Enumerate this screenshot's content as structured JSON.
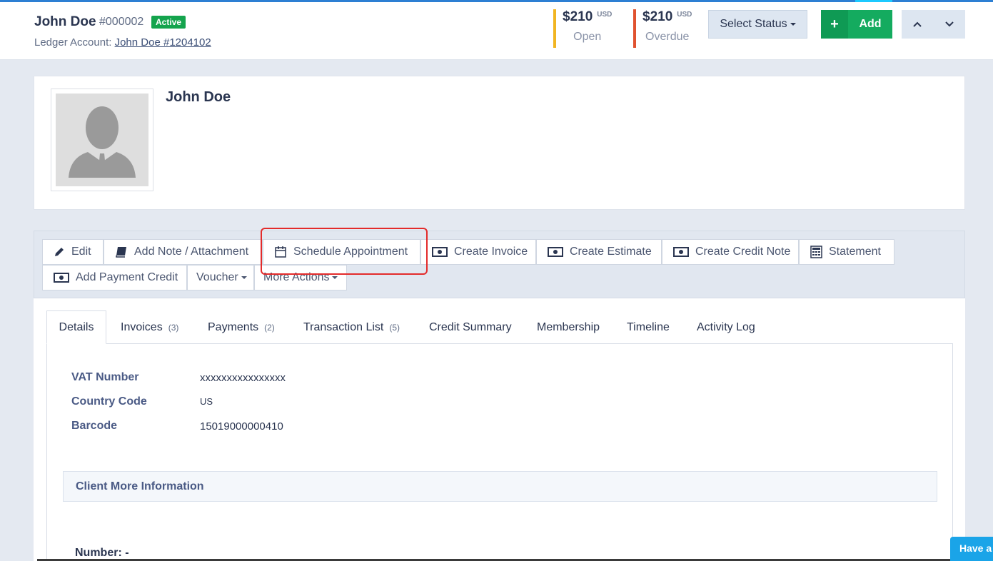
{
  "header": {
    "client_name": "John Doe",
    "client_code": "#000002",
    "status_badge": "Active",
    "ledger_label": "Ledger Account:",
    "ledger_link": "John Doe #1204102",
    "open": {
      "value": "$210",
      "currency": "USD",
      "label": "Open"
    },
    "overdue": {
      "value": "$210",
      "currency": "USD",
      "label": "Overdue"
    },
    "select_status": "Select Status",
    "add_label": "Add"
  },
  "profile": {
    "name": "John Doe"
  },
  "actions": {
    "edit": "Edit",
    "add_note": "Add Note / Attachment",
    "schedule": "Schedule Appointment",
    "create_invoice": "Create Invoice",
    "create_estimate": "Create Estimate",
    "create_credit_note": "Create Credit Note",
    "statement": "Statement",
    "add_payment_credit": "Add Payment Credit",
    "voucher": "Voucher",
    "more_actions": "More Actions"
  },
  "tabs": [
    {
      "label": "Details",
      "count": ""
    },
    {
      "label": "Invoices",
      "count": "(3)"
    },
    {
      "label": "Payments",
      "count": "(2)"
    },
    {
      "label": "Transaction List",
      "count": "(5)"
    },
    {
      "label": "Credit Summary",
      "count": ""
    },
    {
      "label": "Membership",
      "count": ""
    },
    {
      "label": "Timeline",
      "count": ""
    },
    {
      "label": "Activity Log",
      "count": ""
    }
  ],
  "details": {
    "vat_label": "VAT Number",
    "vat_value": "xxxxxxxxxxxxxxxx",
    "country_label": "Country Code",
    "country_value": "US",
    "barcode_label": "Barcode",
    "barcode_value": "15019000000410",
    "more_info_title": "Client More Information",
    "number_label": "Number: -"
  },
  "chat": {
    "label": "Have a question?"
  },
  "colors": {
    "accent_blue": "#2d7fd3",
    "active_green": "#14a44d",
    "open_yellow": "#f1b522",
    "overdue_red": "#e05230",
    "highlight_red": "#e32b2b"
  }
}
